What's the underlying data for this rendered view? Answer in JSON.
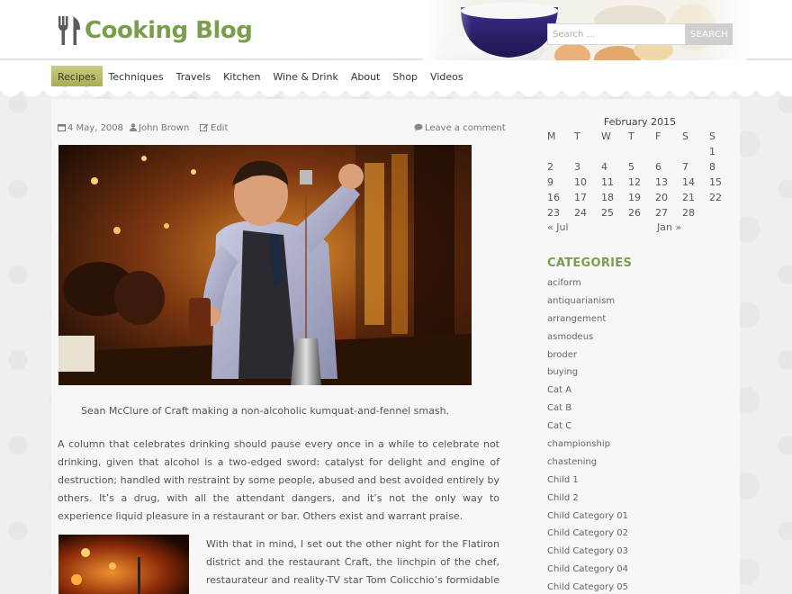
{
  "site": {
    "title": "Cooking Blog",
    "brand_color": "#7a9e4b",
    "logo_icon": "fork-knife-icon"
  },
  "search": {
    "placeholder": "Search ...",
    "button_label": "SEARCH"
  },
  "nav": {
    "items": [
      "Recipes",
      "Techniques",
      "Travels",
      "Kitchen",
      "Wine & Drink",
      "About",
      "Shop",
      "Videos"
    ],
    "active_index": 0
  },
  "post": {
    "date": "4 May, 2008",
    "author": "John Brown",
    "edit_label": "Edit",
    "comment_label": "Leave a comment",
    "caption": "Sean McClure of Craft making a non-alcoholic kumquat-and-fennel smash.",
    "paragraph1": "A column that celebrates drinking should pause every once in a while to celebrate not drinking, given that alcohol is a two-edged sword: catalyst for delight and engine of destruction; handled with restraint by some people, abused and best avoided entirely by others. It’s a drug, with all the attendant dangers, and it’s not the only way to experience liquid pleasure in a restaurant or bar. Others exist and warrant praise.",
    "paragraph2": "With that in mind, I set out the other night for the Flatiron district and the restaurant Craft, the linchpin of the chef, restaurateur and reality-TV star Tom Colicchio’s formidable empire. Craft"
  },
  "calendar": {
    "caption": "February 2015",
    "weekdays": [
      "M",
      "T",
      "W",
      "T",
      "F",
      "S",
      "S"
    ],
    "weeks": [
      [
        "",
        "",
        "",
        "",
        "",
        "",
        "1"
      ],
      [
        "2",
        "3",
        "4",
        "5",
        "6",
        "7",
        "8"
      ],
      [
        "9",
        "10",
        "11",
        "12",
        "13",
        "14",
        "15"
      ],
      [
        "16",
        "17",
        "18",
        "19",
        "20",
        "21",
        "22"
      ],
      [
        "23",
        "24",
        "25",
        "26",
        "27",
        "28",
        ""
      ]
    ],
    "prev_label": "« Jul",
    "next_label": "Jan »"
  },
  "categories": {
    "title": "CATEGORIES",
    "items": [
      "aciform",
      "antiquarianism",
      "arrangement",
      "asmodeus",
      "broder",
      "buying",
      "Cat A",
      "Cat B",
      "Cat C",
      "championship",
      "chastening",
      "Child 1",
      "Child 2",
      "Child Category 01",
      "Child Category 02",
      "Child Category 03",
      "Child Category 04",
      "Child Category 05"
    ]
  }
}
